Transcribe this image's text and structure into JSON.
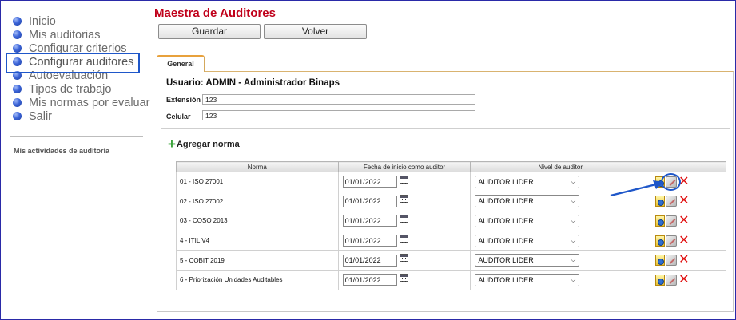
{
  "sidebar": {
    "items": [
      {
        "label": "Inicio"
      },
      {
        "label": "Mis auditorias"
      },
      {
        "label": "Configurar criterios"
      },
      {
        "label": "Configurar auditores"
      },
      {
        "label": "Autoevaluación"
      },
      {
        "label": "Tipos de trabajo"
      },
      {
        "label": "Mis normas por evaluar"
      },
      {
        "label": "Salir"
      }
    ],
    "active_item": "Configurar auditores",
    "caption": "Mis actividades de auditoria"
  },
  "header": {
    "title": "Maestra de Auditores",
    "save_label": "Guardar",
    "back_label": "Volver"
  },
  "tabs": [
    {
      "label": "General"
    }
  ],
  "form": {
    "user_line": "Usuario: ADMIN - Administrador Binaps",
    "extension_label": "Extensión",
    "extension_value": "123",
    "celular_label": "Celular",
    "celular_value": "123"
  },
  "add_norm_label": "Agregar norma",
  "table": {
    "headers": [
      "Norma",
      "Fecha de inicio como auditor",
      "Nivel de auditor",
      ""
    ],
    "rows": [
      {
        "norma": "01 - ISO 27001",
        "fecha": "01/01/2022",
        "nivel": "AUDITOR LIDER"
      },
      {
        "norma": "02 - ISO 27002",
        "fecha": "01/01/2022",
        "nivel": "AUDITOR LIDER"
      },
      {
        "norma": "03 - COSO 2013",
        "fecha": "01/01/2022",
        "nivel": "AUDITOR LIDER"
      },
      {
        "norma": "4 - ITIL V4",
        "fecha": "01/01/2022",
        "nivel": "AUDITOR LIDER"
      },
      {
        "norma": "5 - COBIT 2019",
        "fecha": "01/01/2022",
        "nivel": "AUDITOR LIDER"
      },
      {
        "norma": "6 - Priorización Unidades Auditables",
        "fecha": "01/01/2022",
        "nivel": "AUDITOR LIDER"
      }
    ]
  },
  "colors": {
    "title": "#c0001a",
    "highlight": "#1f57c9",
    "tab_accent": "#e8a13c",
    "delete": "#e01010",
    "add": "#3aa33a"
  }
}
